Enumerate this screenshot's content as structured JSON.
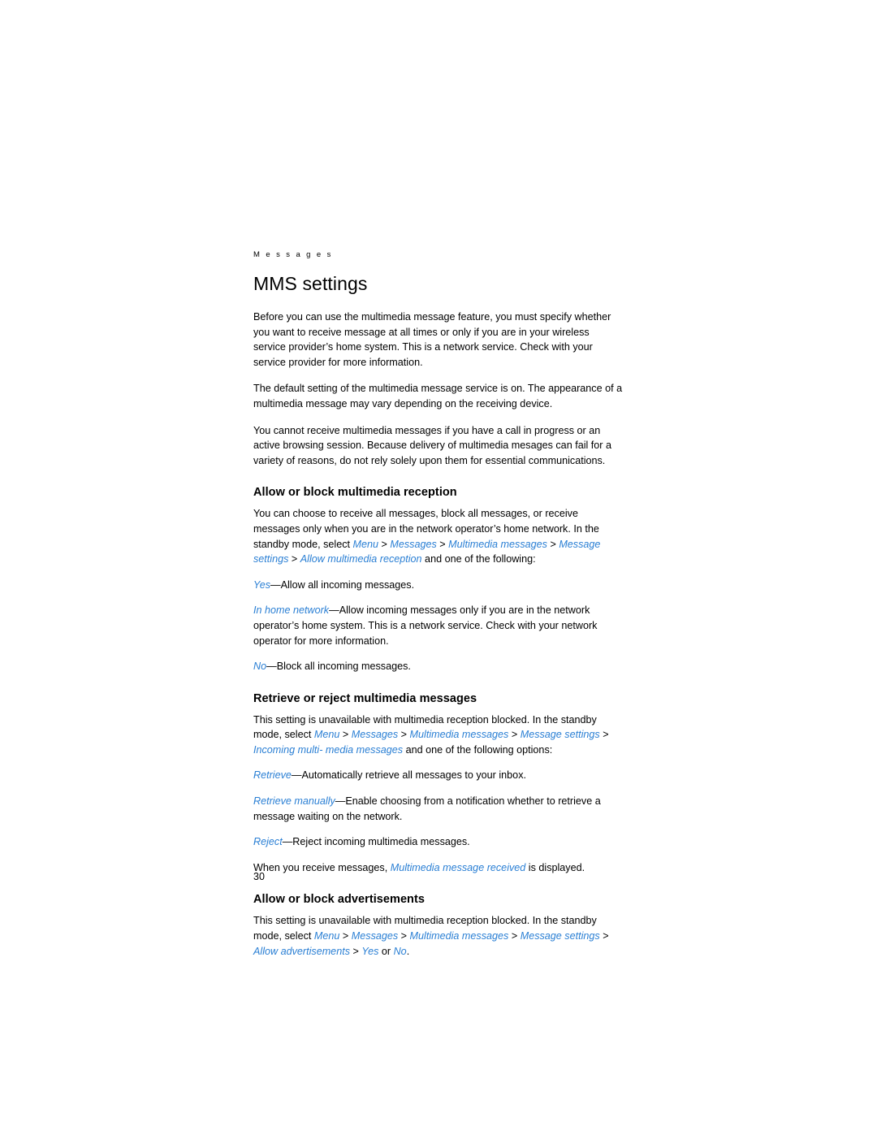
{
  "page": {
    "running_head": "M e s s a g e s",
    "folio": "30",
    "accent_color": "#2a7fd4"
  },
  "chapter": {
    "title": "MMS settings"
  },
  "intro": {
    "p1": "Before you can use the multimedia message feature, you must specify whether you want to receive message at all times or only if you are in your wireless service provider’s home system. This is a network service. Check with your service provider for more information.",
    "p2": "The default setting of the multimedia message service is on. The appearance of a multimedia message may vary depending on the receiving device.",
    "p3": "You cannot receive multimedia messages if you have a call in progress or an active browsing session. Because delivery of multimedia mesages can fail for a variety of reasons, do not rely solely upon them for essential communications."
  },
  "sections": [
    {
      "id": "allow-or-block-multimedia-reception",
      "heading": "Allow or block multimedia reception",
      "p1_a": "You can choose to receive all messages, block all messages, or receive messages only when you are in the network operator’s home network. In the standby mode, select ",
      "p1_menu1": "Menu",
      "sep1": " > ",
      "p1_menu2": "Messages",
      "sep2": " > ",
      "p1_menu3": "Multimedia messages",
      "sep3": " > ",
      "p1_menu4": "Message settings",
      "sep4": " > ",
      "p1_menu5": "Allow multimedia reception",
      "p1_b": " and one of the following:",
      "opt1_term": "Yes",
      "opt1_desc": "—Allow all incoming messages.",
      "opt2_term": "In home network",
      "opt2_desc": "—Allow incoming messages only if you are in the network operator’s home system. This is a network service. Check with your network operator for more information.",
      "opt3_term": "No",
      "opt3_desc": "—Block all incoming messages."
    },
    {
      "id": "retrieve-or-reject-multimedia-messages",
      "heading": "Retrieve or reject multimedia messages",
      "p1_a": "This setting is unavailable with multimedia reception blocked. In the standby mode, select ",
      "p1_menu1": "Menu",
      "p1_menu2": "Messages",
      "p1_menu3": "Multimedia messages",
      "p1_menu4": "Message settings",
      "p1_menu5": "Incoming multi- media messages",
      "p1_b": " and one of the following options:",
      "opt1_term": "Retrieve",
      "opt1_desc": "—Automatically retrieve all messages to your inbox.",
      "opt2_term": "Retrieve manually",
      "opt2_desc": "—Enable choosing from a notification whether to retrieve a message waiting on the network.",
      "opt3_term": "Reject",
      "opt3_desc": "—Reject incoming multimedia messages.",
      "note_a": "When you receive messages, ",
      "note_ui": "Multimedia message received",
      "note_b": " is displayed."
    },
    {
      "id": "allow-or-block-advertisements",
      "heading": "Allow or block advertisements",
      "p1_a": "This setting is unavailable with multimedia reception blocked. In the standby mode, select ",
      "p1_menu1": "Menu",
      "p1_menu2": "Messages",
      "p1_menu3": "Multimedia messages",
      "p1_menu4": "Message settings",
      "p1_menu5": "Allow advertisements",
      "p1_yes": "Yes",
      "p1_or": " or ",
      "p1_no": "No",
      "p1_end": "."
    }
  ]
}
